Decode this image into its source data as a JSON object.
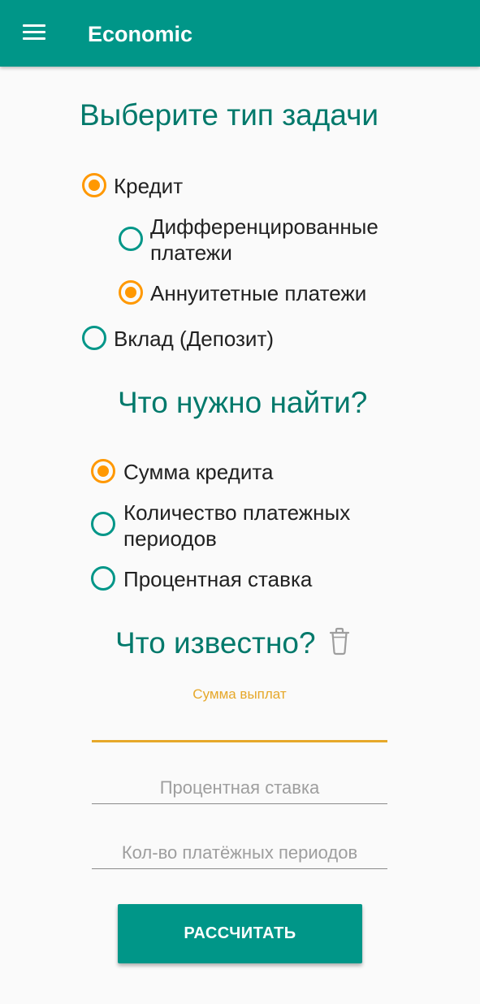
{
  "appbar": {
    "title": "Economic",
    "menu_icon": "hamburger-menu-icon",
    "color": "#009688"
  },
  "task_type": {
    "heading": "Выберите тип задачи",
    "options": [
      {
        "label": "Кредит",
        "checked": true
      },
      {
        "label": "Дифференцированные платежи",
        "checked": false
      },
      {
        "label": "Аннуитетные платежи",
        "checked": true
      },
      {
        "label": "Вклад (Депозит)",
        "checked": false
      }
    ]
  },
  "find": {
    "heading": "Что нужно найти?",
    "options": [
      {
        "label": "Сумма кредита",
        "checked": true
      },
      {
        "label": "Количество платежных периодов",
        "checked": false
      },
      {
        "label": "Процентная ставка",
        "checked": false
      }
    ]
  },
  "known": {
    "heading": "Что известно?",
    "clear_icon": "trash-icon",
    "fields": [
      {
        "label": "Сумма выплат",
        "value": "",
        "placeholder": "",
        "focused": true
      },
      {
        "label": "",
        "value": "",
        "placeholder": "Процентная ставка",
        "focused": false
      },
      {
        "label": "",
        "value": "",
        "placeholder": "Кол-во платёжных периодов",
        "focused": false
      }
    ]
  },
  "calculate_button": {
    "label": "РАССЧИТАТЬ"
  },
  "colors": {
    "primary": "#009688",
    "heading": "#00796b",
    "accent": "#ff9800",
    "focus_underline": "#e6a82a"
  }
}
